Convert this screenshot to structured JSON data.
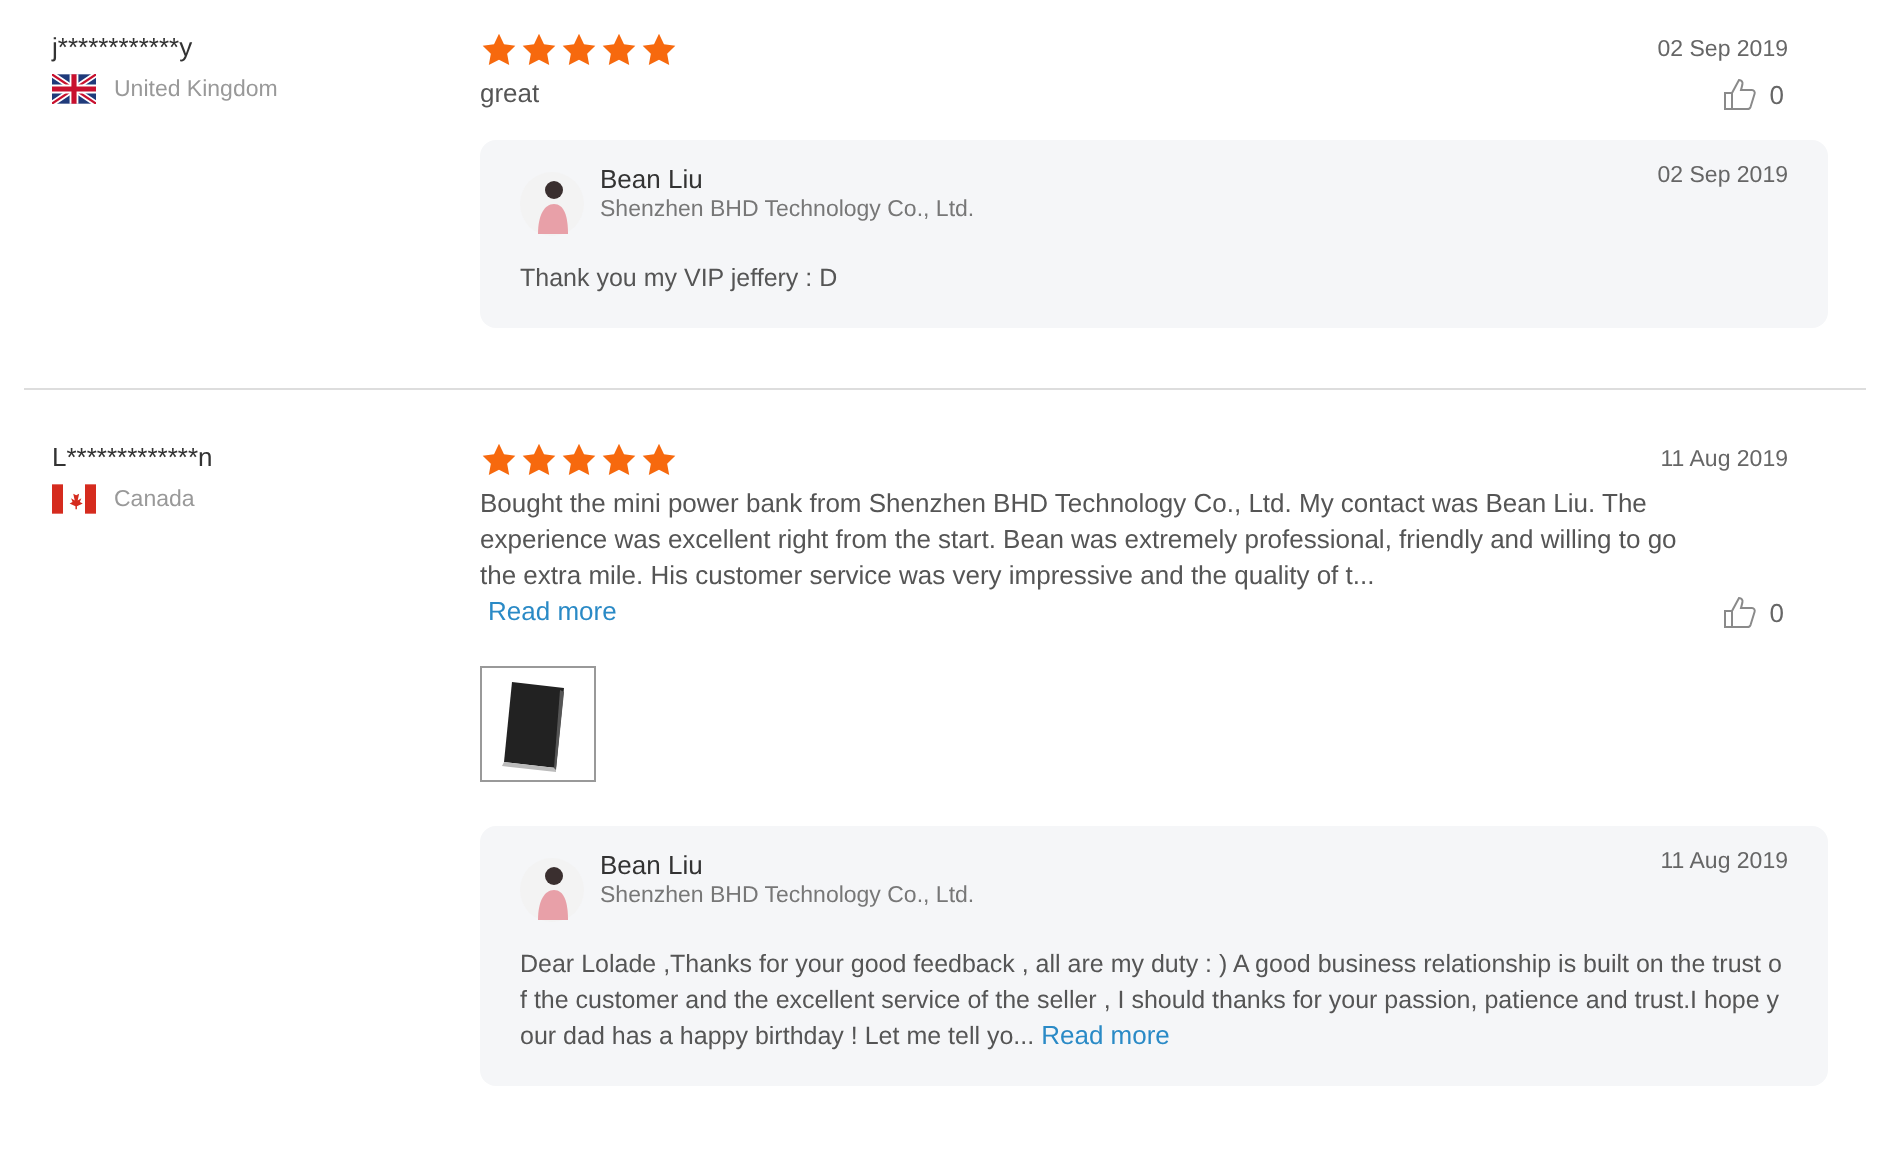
{
  "reviews": [
    {
      "reviewer": "j************y",
      "country": "United Kingdom",
      "flag": {
        "kind": "uk"
      },
      "stars": 5,
      "date": "02 Sep 2019",
      "text": "great",
      "likes": "0",
      "reply": {
        "name": "Bean Liu",
        "company": "Shenzhen BHD Technology Co., Ltd.",
        "date": "02 Sep 2019",
        "text": "Thank you my VIP jeffery : D"
      }
    },
    {
      "reviewer": "L*************n",
      "country": "Canada",
      "flag": {
        "kind": "ca"
      },
      "stars": 5,
      "date": "11 Aug 2019",
      "text": "Bought the mini power bank from  Shenzhen BHD Technology Co., Ltd. My contact was Bean Liu. The experience was excellent right from the start. Bean was extremely professional, friendly and willing to go the extra mile. His customer service was very impressive and the quality of t...",
      "read_more": "Read more",
      "likes": "0",
      "photos": [
        {
          "kind": "picture"
        }
      ],
      "reply": {
        "name": "Bean Liu",
        "company": "Shenzhen BHD Technology Co., Ltd.",
        "date": "11 Aug 2019",
        "text": "Dear Lolade ,Thanks for your good feedback , all are my duty : ) A good business relationship is built on the trust of the customer and the excellent service of the seller , I should thanks for your passion, patience and trust.I hope your dad has a happy birthday ! Let me tell yo...",
        "read_more": "Read more"
      }
    }
  ]
}
